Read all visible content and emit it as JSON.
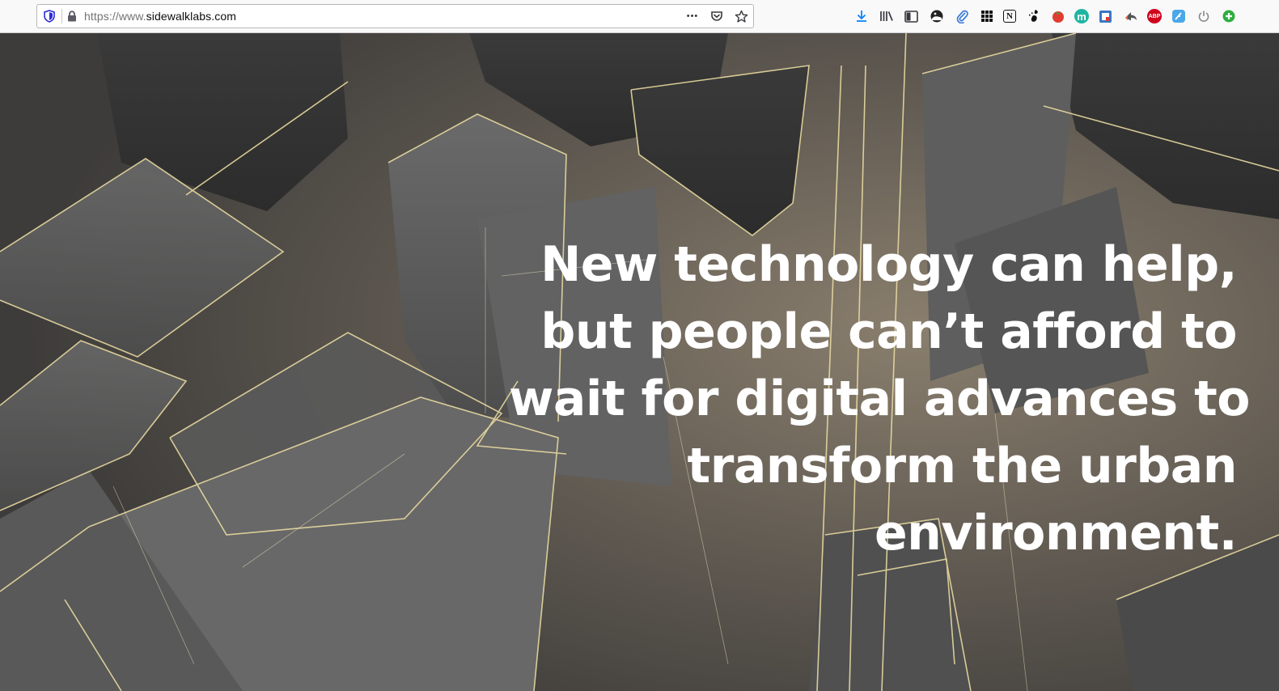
{
  "browser": {
    "url_prefix": "https://www.",
    "url_domain": "sidewalklabs.com",
    "page_actions": {
      "more": "•••"
    },
    "extensions": [
      {
        "name": "downloads-icon",
        "color": "#0a84ff"
      },
      {
        "name": "library-icon",
        "color": "#38383d"
      },
      {
        "name": "sidebar-icon",
        "color": "#38383d"
      },
      {
        "name": "dark-reader-icon",
        "color": "#222222"
      },
      {
        "name": "paperclip-icon",
        "color": "#3d7bd8"
      },
      {
        "name": "grid-apps-icon",
        "color": "#111111"
      },
      {
        "name": "notion-icon",
        "color": "#111111"
      },
      {
        "name": "gnome-icon",
        "color": "#111111"
      },
      {
        "name": "tomato-icon",
        "color": "#e03c31"
      },
      {
        "name": "mercury-icon",
        "color": "#1fb5a0"
      },
      {
        "name": "reader-icon",
        "color": "#3a77c4"
      },
      {
        "name": "arrow-ext-icon",
        "color": "#555555"
      },
      {
        "name": "adblock-plus-icon",
        "color": "#d0021b"
      },
      {
        "name": "feather-icon",
        "color": "#4aa8e8"
      },
      {
        "name": "power-icon",
        "color": "#777777"
      },
      {
        "name": "plus-green-icon",
        "color": "#2eae3f"
      }
    ],
    "extension_labels": {
      "adblock": "ABP",
      "mercury": "m",
      "notion": "N"
    }
  },
  "hero": {
    "headline_lines": [
      "New technology can help,",
      "but people can’t afford to",
      "wait for digital advances to",
      "transform the urban",
      "environment."
    ],
    "colors": {
      "text": "#ffffff",
      "glow_line": "#e8d9a0",
      "building": "#5a5a5a"
    }
  }
}
